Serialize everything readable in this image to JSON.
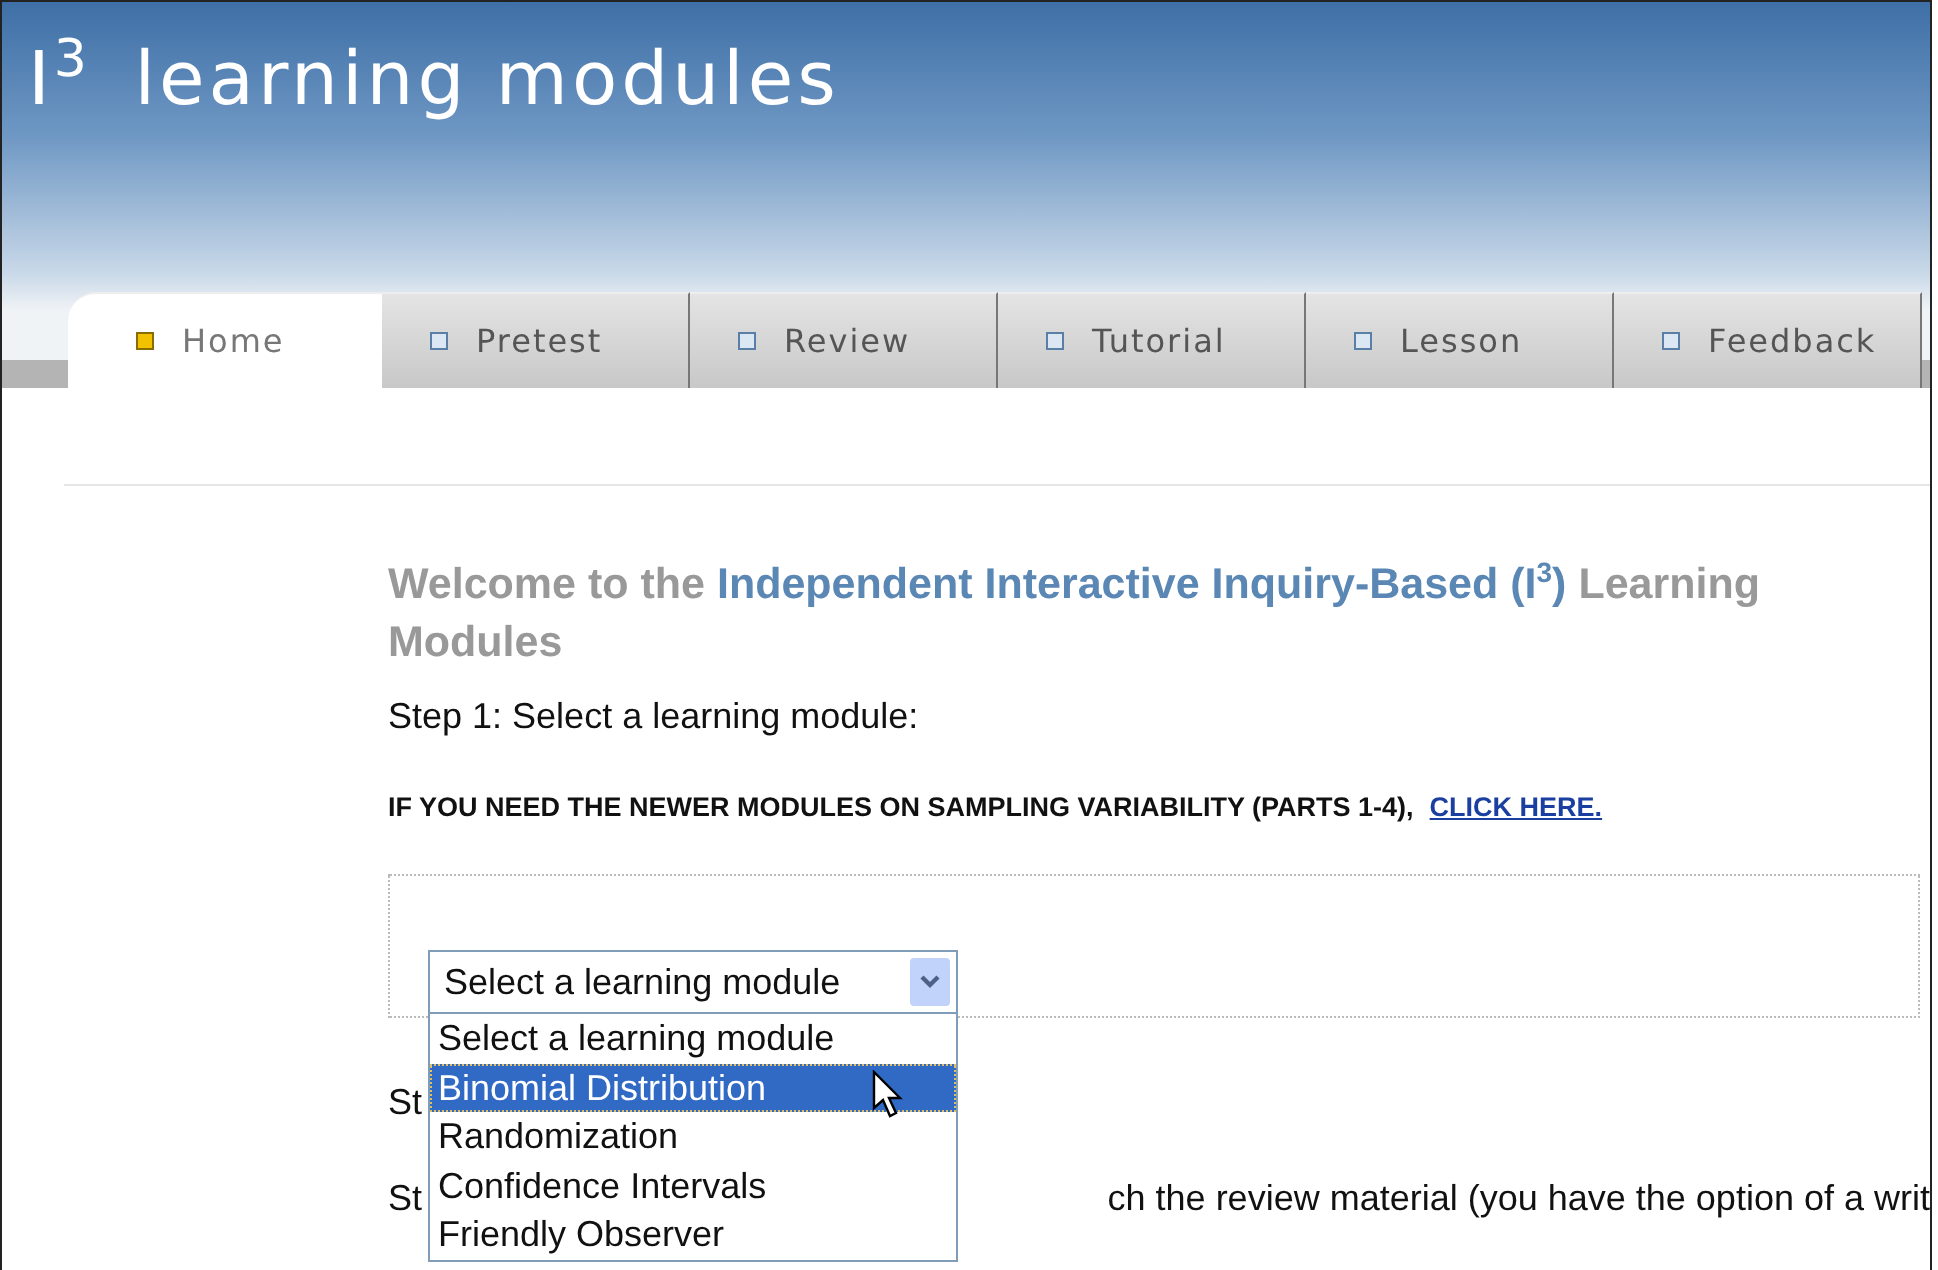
{
  "header": {
    "title": "I$^{3}$ learning modules"
  },
  "tabs": [
    {
      "label": "Home",
      "selected": true
    },
    {
      "label": "Pretest",
      "selected": false
    },
    {
      "label": "Review",
      "selected": false
    },
    {
      "label": "Tutorial",
      "selected": false
    },
    {
      "label": "Lesson",
      "selected": false
    },
    {
      "label": "Feedback",
      "selected": false
    }
  ],
  "heading": [
    {
      "kind": "plain",
      "text": "Welcome to the "
    },
    {
      "kind": "accent",
      "text": "Independent Interactive Inquiry-Based (I$^{3}$)"
    },
    {
      "kind": "plain",
      "text": " Learning Modules"
    }
  ],
  "step1": "Step 1: Select a learning module:",
  "notice": {
    "text": "IF YOU NEED THE NEWER MODULES ON SAMPLING VARIABILITY (PARTS 1-4),",
    "link": "CLICK HERE."
  },
  "select": {
    "value": "Select a learning module",
    "expanded": true,
    "options": [
      {
        "label": "Select a learning module",
        "highlighted": false
      },
      {
        "label": "Binomial Distribution",
        "highlighted": true
      },
      {
        "label": "Randomization",
        "highlighted": false
      },
      {
        "label": "Confidence Intervals",
        "highlighted": false
      },
      {
        "label": "Friendly Observer",
        "highlighted": false
      }
    ]
  },
  "hidden_lines": [
    {
      "start": "St"
    },
    {
      "start": "St",
      "rest": "ch the review material (you have the option of a writ"
    }
  ]
}
